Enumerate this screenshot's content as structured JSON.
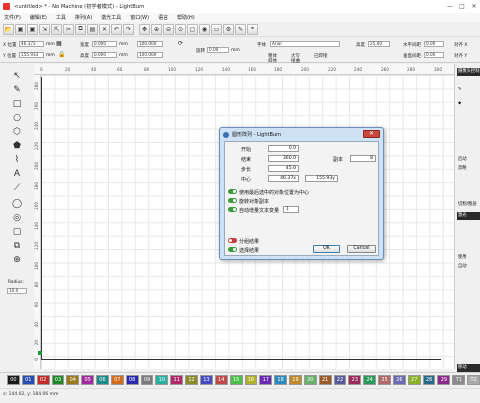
{
  "window": {
    "title": "<untitled> * - No Machine (初学者模式) - LightBurn",
    "controls": [
      "—",
      "□",
      "✕"
    ]
  },
  "menu": [
    "文件(F)",
    "编辑(E)",
    "工具",
    "排列(A)",
    "激光工具",
    "窗口(W)",
    "语言",
    "帮助(H)"
  ],
  "props": {
    "x_label": "X 位置",
    "x_value": "46.372",
    "y_label": "Y 位置",
    "y_value": "155.933",
    "unit": "mm",
    "width_label": "宽度",
    "width_value": "0.000",
    "height_label": "高度",
    "height_value": "0.000",
    "pct1": "100.000",
    "pct2": "100.000",
    "rotate_label": "旋转",
    "rotate_value": "0.00",
    "font_label": "字体",
    "font_value": "Arial",
    "height2_label": "高度",
    "height2_value": "25.00",
    "hspace_label": "水平间距",
    "hspace_value": "0.00",
    "vspace_label": "垂直间距",
    "vspace_value": "0.00",
    "align_x": "对齐 X",
    "align_y": "对齐 Y",
    "bold": "粗体",
    "italic": "斜体",
    "upper": "大写",
    "welded": "已焊接",
    "distort": "扭曲"
  },
  "ruler": {
    "top": [
      "0",
      "20",
      "40",
      "60",
      "80",
      "100",
      "120",
      "140",
      "160",
      "180",
      "200",
      "220",
      "240",
      "260",
      "280",
      "300"
    ],
    "left": [
      "280",
      "260",
      "240",
      "220",
      "200",
      "180",
      "160",
      "140",
      "120",
      "100",
      "80",
      "60",
      "40",
      "20",
      "0"
    ]
  },
  "left_tools": [
    "↖",
    "✎",
    "□",
    "○",
    "⬡",
    "⬟",
    "⌇",
    "A",
    "⟋",
    "◯",
    "◎",
    "▢",
    "⧉",
    "⊕"
  ],
  "radius": {
    "label": "Radius:",
    "value": "10.0"
  },
  "right_panel": {
    "tabs": [
      "摄像头控制",
      "删除",
      "复制",
      "激光",
      "移动"
    ],
    "items": [
      "启动",
      "忽略"
    ],
    "labels": [
      "切割/图层",
      "激光",
      "使用",
      "自动"
    ]
  },
  "palette": [
    "00",
    "01",
    "02",
    "03",
    "04",
    "05",
    "06",
    "07",
    "08",
    "09",
    "10",
    "11",
    "12",
    "13",
    "14",
    "15",
    "16",
    "17",
    "18",
    "19",
    "20",
    "21",
    "22",
    "23",
    "24",
    "25",
    "26",
    "27",
    "28",
    "29",
    "T1",
    "T2"
  ],
  "palette_colors": [
    "#1a1a1a",
    "#2a4fb0",
    "#c42a2a",
    "#1e8a2a",
    "#9a7a18",
    "#a02aa0",
    "#1a8a8a",
    "#d26b1a",
    "#2a2ab0",
    "#7a7a7a",
    "#2ab0a0",
    "#b02a6a",
    "#8a8a2a",
    "#4a4ac0",
    "#c04a4a",
    "#4ac04a",
    "#b0b02a",
    "#6a2ab0",
    "#2a8ac0",
    "#c08a2a",
    "#6ab06a",
    "#9a5a2a",
    "#5a5a9a",
    "#9a2a5a",
    "#2a9a5a",
    "#b06a6a",
    "#6a6ab0",
    "#8ab02a",
    "#2a6a8a",
    "#8a2a8a",
    "#8a8a8a",
    "#aaaaaa"
  ],
  "status": "x: 144.02, y: 184.06 mm",
  "dialog": {
    "title": "圆形阵列 - LightBurn",
    "start_label": "开始",
    "start_value": "0.0",
    "end_label": "结束",
    "end_value": "360.0",
    "copies_label": "副本",
    "copies_value": "8",
    "step_label": "步长",
    "step_value": "45.0",
    "center_label": "中心",
    "center_x": "46.37x",
    "center_y": "155.93y",
    "opt_last_center": "使用最后选中的对象位置为中心",
    "opt_rotate": "旋转对象副本",
    "opt_autotext": "自动增量文本变量",
    "opt_autotext_value": "1",
    "opt_group": "分组结果",
    "opt_select": "选择结果",
    "ok": "OK",
    "cancel": "Cancel"
  }
}
